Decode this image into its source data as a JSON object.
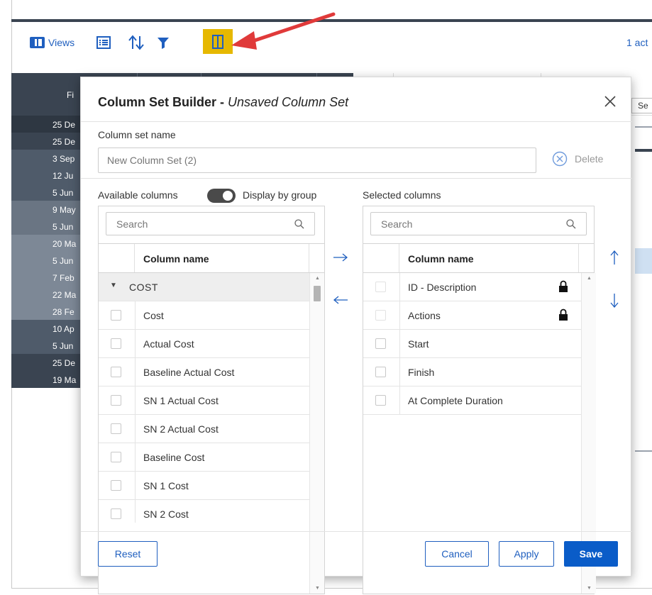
{
  "toolbar": {
    "views_label": "Views",
    "activity_count": "1 act"
  },
  "background": {
    "header_text": "Fi",
    "sep_tab": "Se",
    "rows": [
      "25 De",
      "25 De",
      "3 Sep",
      "12 Ju",
      "5 Jun",
      "9 May",
      "5 Jun",
      "20 Ma",
      "5 Jun",
      "7 Feb",
      "22 Ma",
      "28 Fe",
      "10 Ap",
      "5 Jun",
      "25 De",
      "19 Ma"
    ]
  },
  "modal": {
    "title_bold": "Column Set Builder - ",
    "title_italic": "Unsaved Column Set",
    "name_label": "Column set name",
    "name_placeholder": "New Column Set (2)",
    "delete_label": "Delete",
    "available_label": "Available columns",
    "display_by_group_label": "Display by group",
    "selected_label": "Selected columns",
    "search_placeholder": "Search",
    "column_name_header": "Column name",
    "available": {
      "group": "COST",
      "items": [
        "Cost",
        "Actual Cost",
        "Baseline Actual Cost",
        "SN 1 Actual Cost",
        "SN 2 Actual Cost",
        "Baseline Cost",
        "SN 1 Cost",
        "SN 2 Cost"
      ]
    },
    "selected": {
      "items": [
        "ID - Description",
        "Actions",
        "Start",
        "Finish",
        "At Complete Duration"
      ],
      "locked": [
        true,
        true,
        false,
        false,
        false
      ]
    },
    "buttons": {
      "reset": "Reset",
      "cancel": "Cancel",
      "apply": "Apply",
      "save": "Save"
    }
  }
}
